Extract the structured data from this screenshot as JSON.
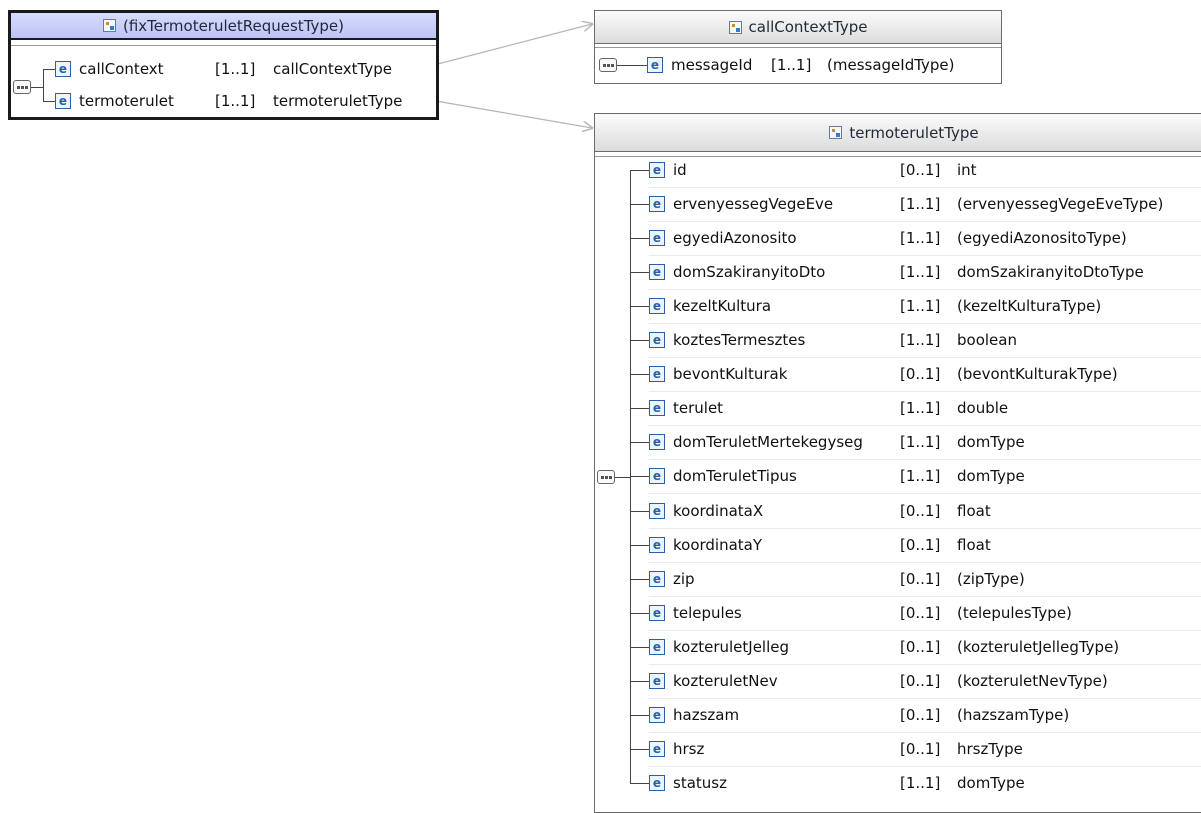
{
  "request_box": {
    "title": "(fixTermoteruletRequestType)",
    "elements": [
      {
        "name": "callContext",
        "mult": "[1..1]",
        "type": "callContextType"
      },
      {
        "name": "termoterulet",
        "mult": "[1..1]",
        "type": "termoteruletType"
      }
    ]
  },
  "call_context_box": {
    "title": "callContextType",
    "elements": [
      {
        "name": "messageId",
        "mult": "[1..1]",
        "type": "(messageIdType)"
      }
    ]
  },
  "termoterulet_box": {
    "title": "termoteruletType",
    "elements": [
      {
        "name": "id",
        "mult": "[0..1]",
        "type": "int"
      },
      {
        "name": "ervenyessegVegeEve",
        "mult": "[1..1]",
        "type": "(ervenyessegVegeEveType)"
      },
      {
        "name": "egyediAzonosito",
        "mult": "[1..1]",
        "type": "(egyediAzonositoType)"
      },
      {
        "name": "domSzakiranyitoDto",
        "mult": "[1..1]",
        "type": "domSzakiranyitoDtoType"
      },
      {
        "name": "kezeltKultura",
        "mult": "[1..1]",
        "type": "(kezeltKulturaType)"
      },
      {
        "name": "koztesTermesztes",
        "mult": "[1..1]",
        "type": "boolean"
      },
      {
        "name": "bevontKulturak",
        "mult": "[0..1]",
        "type": "(bevontKulturakType)"
      },
      {
        "name": "terulet",
        "mult": "[1..1]",
        "type": "double"
      },
      {
        "name": "domTeruletMertekegyseg",
        "mult": "[1..1]",
        "type": "domType"
      },
      {
        "name": "domTeruletTipus",
        "mult": "[1..1]",
        "type": "domType"
      },
      {
        "name": "koordinataX",
        "mult": "[0..1]",
        "type": "float"
      },
      {
        "name": "koordinataY",
        "mult": "[0..1]",
        "type": "float"
      },
      {
        "name": "zip",
        "mult": "[0..1]",
        "type": "(zipType)"
      },
      {
        "name": "telepules",
        "mult": "[0..1]",
        "type": "(telepulesType)"
      },
      {
        "name": "kozteruletJelleg",
        "mult": "[0..1]",
        "type": "(kozteruletJellegType)"
      },
      {
        "name": "kozteruletNev",
        "mult": "[0..1]",
        "type": "(kozteruletNevType)"
      },
      {
        "name": "hazszam",
        "mult": "[0..1]",
        "type": "(hazszamType)"
      },
      {
        "name": "hrsz",
        "mult": "[0..1]",
        "type": "hrszType"
      },
      {
        "name": "statusz",
        "mult": "[1..1]",
        "type": "domType"
      }
    ]
  },
  "colors": {
    "selected_header": "#c9cdf8",
    "header": "#e6e6e6",
    "element_icon": "#2d5fa8",
    "connector": "#b5b5b5"
  },
  "icons": {
    "type": "complex-type-icon",
    "element": "element-icon",
    "compositor": "sequence-icon"
  }
}
